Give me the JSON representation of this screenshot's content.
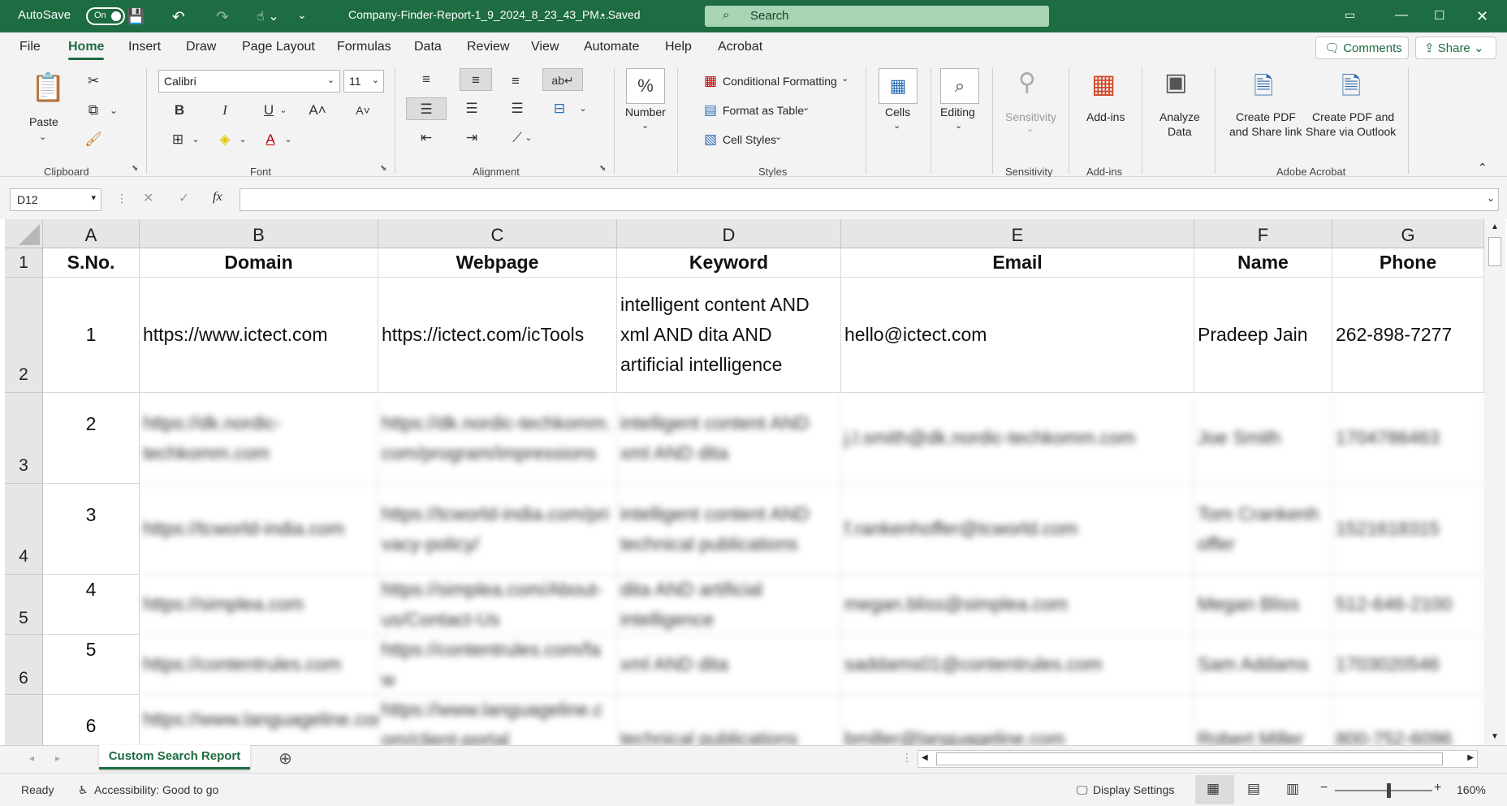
{
  "titlebar": {
    "autosave_label": "AutoSave",
    "autosave_state": "On",
    "filename": "Company-Finder-Report-1_9_2024_8_23_43_PM...",
    "saved_status": "• Saved",
    "search_placeholder": "Search"
  },
  "menu": {
    "items": [
      "File",
      "Home",
      "Insert",
      "Draw",
      "Page Layout",
      "Formulas",
      "Data",
      "Review",
      "View",
      "Automate",
      "Help",
      "Acrobat"
    ],
    "active": "Home",
    "comments_label": "Comments",
    "share_label": "Share"
  },
  "ribbon": {
    "clipboard": {
      "paste_label": "Paste",
      "group_label": "Clipboard"
    },
    "font": {
      "font_name": "Calibri",
      "font_size": "11",
      "group_label": "Font"
    },
    "alignment": {
      "group_label": "Alignment"
    },
    "number": {
      "label": "Number"
    },
    "styles": {
      "conditional_formatting": "Conditional Formatting",
      "format_as_table": "Format as Table",
      "cell_styles": "Cell Styles",
      "group_label": "Styles"
    },
    "cells": {
      "label": "Cells"
    },
    "editing": {
      "label": "Editing"
    },
    "sensitivity": {
      "label": "Sensitivity",
      "group_label": "Sensitivity"
    },
    "addins": {
      "label": "Add-ins",
      "group_label": "Add-ins"
    },
    "analyze": {
      "label_1": "Analyze",
      "label_2": "Data"
    },
    "acrobat": {
      "create_share_1": "Create PDF",
      "create_share_2": "and Share link",
      "create_outlook_1": "Create PDF and",
      "create_outlook_2": "Share via Outlook",
      "group_label": "Adobe Acrobat"
    }
  },
  "formula_bar": {
    "name_box": "D12",
    "fx": "fx",
    "value": ""
  },
  "sheet": {
    "columns": [
      "A",
      "B",
      "C",
      "D",
      "E",
      "F",
      "G"
    ],
    "rows": [
      "1",
      "2",
      "3",
      "4",
      "5",
      "6"
    ],
    "headers": [
      "S.No.",
      "Domain",
      "Webpage",
      "Keyword",
      "Email",
      "Name",
      "Phone"
    ],
    "data": [
      [
        "1",
        "https://www.ictect.com",
        "https://ictect.com/icTools",
        "intelligent content AND xml AND dita AND artificial intelligence",
        "hello@ictect.com",
        "Pradeep Jain",
        "262-898-7277"
      ],
      [
        "2",
        "https://dk.nordic-techkomm.com",
        "https://dk.nordic-techkomm.com/program/impressions",
        "intelligent content AND xml AND dita",
        "j.l.smith@dk.nordic-techkomm.com",
        "Joe Smith",
        "1704786463"
      ],
      [
        "3",
        "https://tcworld-india.com",
        "https://tcworld-india.com/privacy-policy/",
        "intelligent content AND technical publications",
        "f.rankenhoffer@tcworld.com",
        "Tom Crankenhoffer",
        "1521618315"
      ],
      [
        "4",
        "https://simplea.com",
        "https://simplea.com/About-us/Contact-Us",
        "dita AND artificial intelligence",
        "megan.bliss@simplea.com",
        "Megan Bliss",
        "512-646-2100"
      ],
      [
        "5",
        "https://contentrules.com",
        "https://contentrules.com/faw",
        "xml AND dita",
        "saddams01@contentrules.com",
        "Sam Addams",
        "1703020546"
      ],
      [
        "6",
        "https://www.languageline.com",
        "https://www.languageline.com/client-portal",
        "technical publications",
        "bmiller@languageline.com",
        "Robert Miller",
        "800-752-6096"
      ]
    ]
  },
  "tabs": {
    "active_sheet": "Custom Search Report"
  },
  "status": {
    "ready": "Ready",
    "accessibility": "Accessibility: Good to go",
    "display_settings": "Display Settings",
    "zoom": "160%"
  }
}
